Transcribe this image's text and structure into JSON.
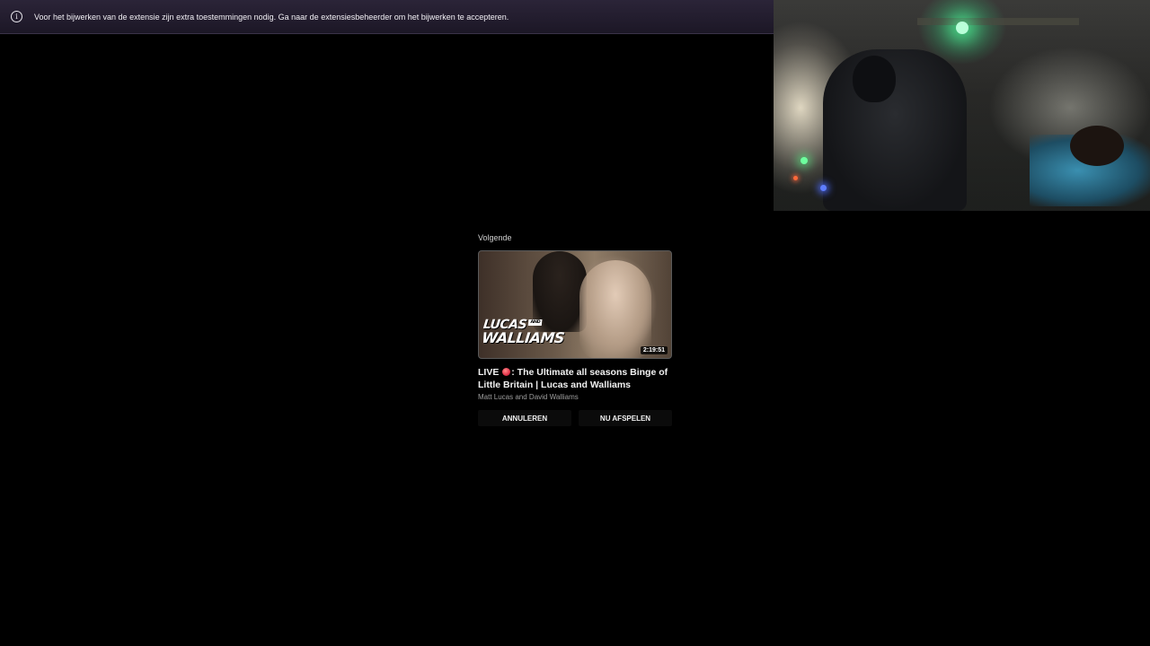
{
  "notification": {
    "icon": "info-icon",
    "icon_glyph": "i",
    "message": "Voor het bijwerken van de extensie zijn extra toestemmingen nodig. Ga naar de extensiesbeheerder om het bijwerken te accepteren."
  },
  "up_next": {
    "label": "Volgende",
    "thumbnail": {
      "logo_line1": "LUCAS",
      "logo_and": "AND",
      "logo_line2": "WALLIAMS",
      "duration": "2:19:51"
    },
    "title_prefix": "LIVE",
    "title_rest": ": The Ultimate all seasons Binge of Little Britain | Lucas and Walliams",
    "channel": "Matt Lucas and David Walliams",
    "cancel_label": "ANNULEREN",
    "play_label": "NU AFSPELEN"
  },
  "colors": {
    "background": "#000000",
    "notification_bar": "#241e30",
    "live_dot": "#e0334a"
  }
}
